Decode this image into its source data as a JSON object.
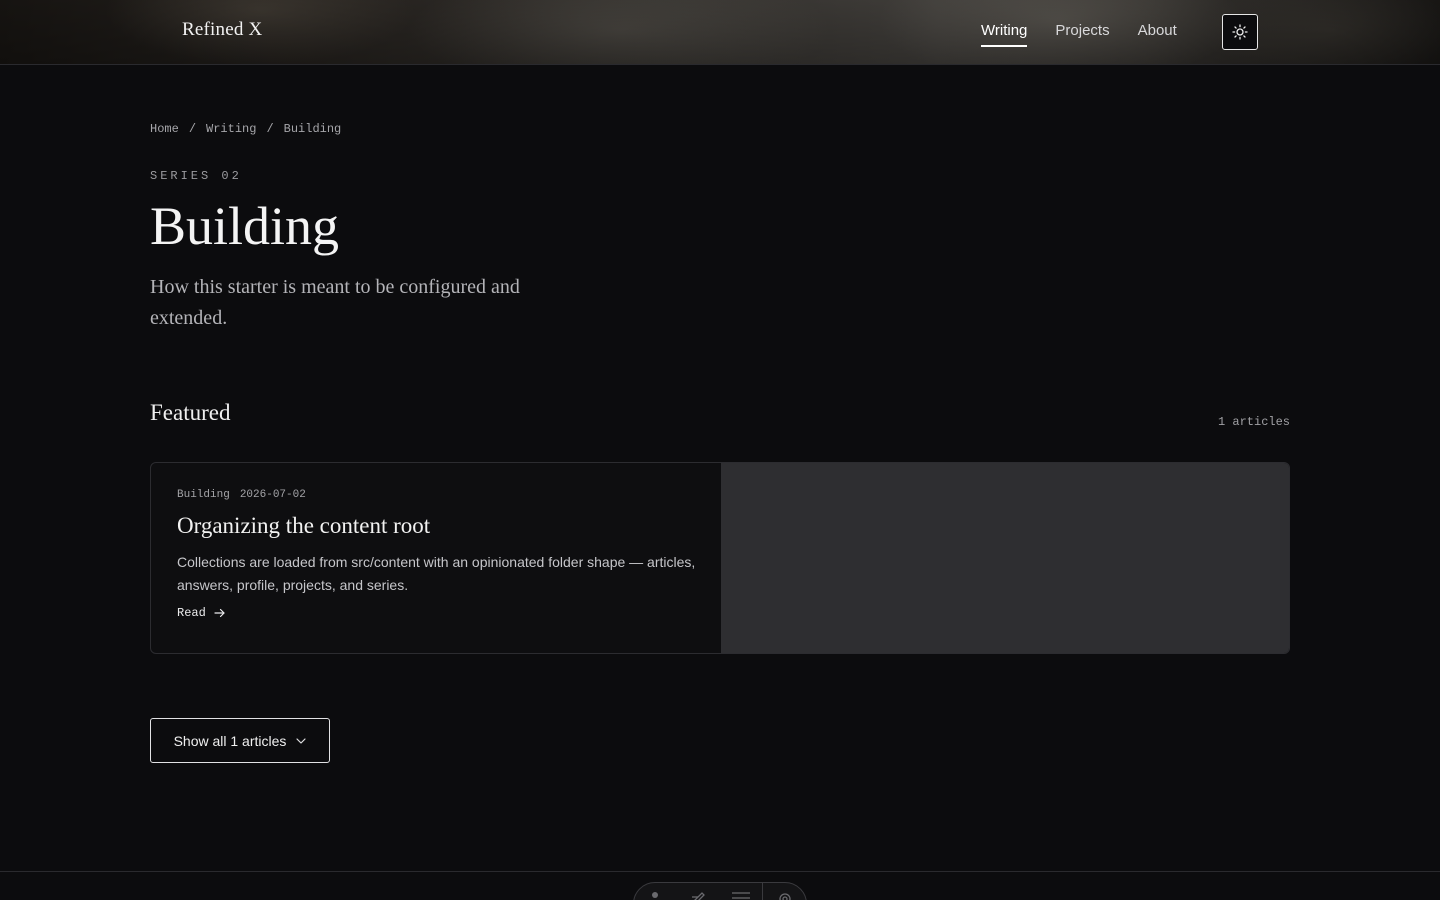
{
  "header": {
    "brand": "Refined X",
    "nav": [
      {
        "label": "Writing",
        "active": true
      },
      {
        "label": "Projects",
        "active": false
      },
      {
        "label": "About",
        "active": false
      }
    ],
    "theme_toggle_icon": "sun-icon"
  },
  "breadcrumb": [
    "Home",
    "/",
    "Writing",
    "/",
    "Building"
  ],
  "series": {
    "eyebrow": "SERIES 02",
    "title": "Building",
    "description": "How this starter is meant to be configured and extended."
  },
  "featured": {
    "heading": "Featured",
    "count": "1 articles",
    "card": {
      "tag": "Building",
      "date": "2026-07-02",
      "title": "Organizing the content root",
      "description": "Collections are loaded from src/content with an opinionated folder shape — articles, answers, profile, projects, and series.",
      "read_label": "Read"
    }
  },
  "show_all_label": "Show all 1 articles",
  "colors": {
    "background": "#0c0c0e",
    "card_image": "#2e2e31"
  }
}
